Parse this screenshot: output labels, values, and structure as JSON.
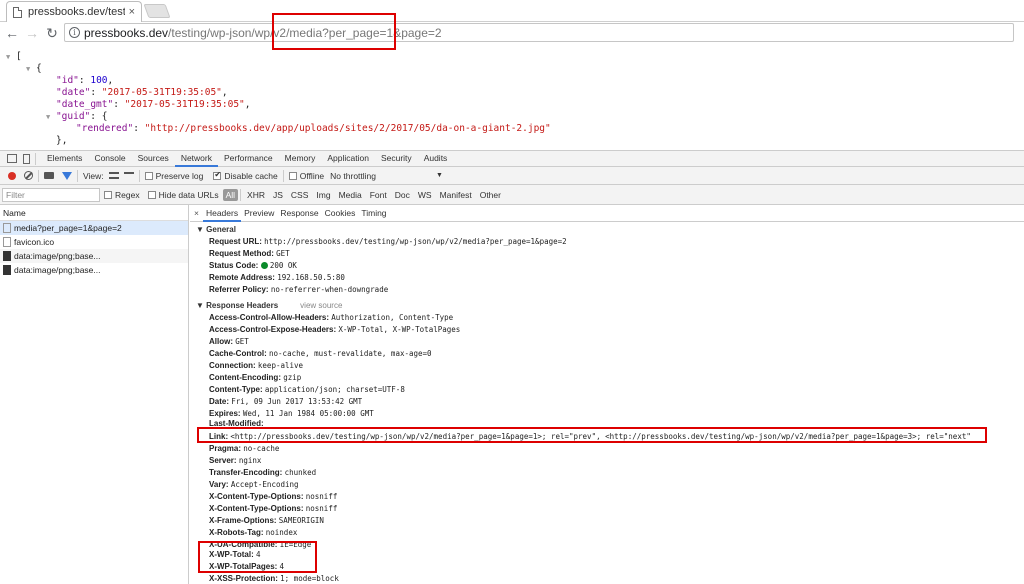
{
  "browser": {
    "tab_title": "pressbooks.dev/testing/w",
    "tab_close": "×",
    "url_host": "pressbooks.dev",
    "url_path": "/testing/wp-json/wp/v2/media?per_page=1&page=2"
  },
  "json_view": {
    "open_bracket": "[",
    "open_brace": "{",
    "id_key": "\"id\"",
    "id_val": "100",
    "date_key": "\"date\"",
    "date_val": "\"2017-05-31T19:35:05\"",
    "date_gmt_key": "\"date_gmt\"",
    "date_gmt_val": "\"2017-05-31T19:35:05\"",
    "guid_key": "\"guid\"",
    "rendered_key": "\"rendered\"",
    "rendered_val": "\"http://pressbooks.dev/app/uploads/sites/2/2017/05/da-on-a-giant-2.jpg\"",
    "close_brace": "},"
  },
  "devtools": {
    "tabs": [
      "Elements",
      "Console",
      "Sources",
      "Network",
      "Performance",
      "Memory",
      "Application",
      "Security",
      "Audits"
    ],
    "active_tab": "Network",
    "toolbar": {
      "view_label": "View:",
      "preserve_log": "Preserve log",
      "disable_cache": "Disable cache",
      "offline": "Offline",
      "throttling": "No throttling"
    },
    "filter": {
      "placeholder": "Filter",
      "regex": "Regex",
      "hide_data_urls": "Hide data URLs",
      "types": [
        "All",
        "XHR",
        "JS",
        "CSS",
        "Img",
        "Media",
        "Font",
        "Doc",
        "WS",
        "Manifest",
        "Other"
      ]
    },
    "requests": {
      "header": "Name",
      "items": [
        "media?per_page=1&page=2",
        "favicon.ico",
        "data:image/png;base...",
        "data:image/png;base..."
      ]
    },
    "detail_tabs": [
      "Headers",
      "Preview",
      "Response",
      "Cookies",
      "Timing"
    ],
    "general": {
      "title": "General",
      "request_url_name": "Request URL:",
      "request_url_value": "http://pressbooks.dev/testing/wp-json/wp/v2/media?per_page=1&page=2",
      "request_method_name": "Request Method:",
      "request_method_value": "GET",
      "status_code_name": "Status Code:",
      "status_code_value": "200 OK",
      "remote_address_name": "Remote Address:",
      "remote_address_value": "192.168.50.5:80",
      "referrer_policy_name": "Referrer Policy:",
      "referrer_policy_value": "no-referrer-when-downgrade"
    },
    "response_headers": {
      "title": "Response Headers",
      "view_source": "view source",
      "items": [
        {
          "name": "Access-Control-Allow-Headers:",
          "value": "Authorization, Content-Type"
        },
        {
          "name": "Access-Control-Expose-Headers:",
          "value": "X-WP-Total, X-WP-TotalPages"
        },
        {
          "name": "Allow:",
          "value": "GET"
        },
        {
          "name": "Cache-Control:",
          "value": "no-cache, must-revalidate, max-age=0"
        },
        {
          "name": "Connection:",
          "value": "keep-alive"
        },
        {
          "name": "Content-Encoding:",
          "value": "gzip"
        },
        {
          "name": "Content-Type:",
          "value": "application/json; charset=UTF-8"
        },
        {
          "name": "Date:",
          "value": "Fri, 09 Jun 2017 13:53:42 GMT"
        },
        {
          "name": "Expires:",
          "value": "Wed, 11 Jan 1984 05:00:00 GMT"
        },
        {
          "name": "Last-Modified:",
          "value": ""
        },
        {
          "name": "Link:",
          "value": "<http://pressbooks.dev/testing/wp-json/wp/v2/media?per_page=1&page=1>; rel=\"prev\", <http://pressbooks.dev/testing/wp-json/wp/v2/media?per_page=1&page=3>; rel=\"next\""
        },
        {
          "name": "Pragma:",
          "value": "no-cache"
        },
        {
          "name": "Server:",
          "value": "nginx"
        },
        {
          "name": "Transfer-Encoding:",
          "value": "chunked"
        },
        {
          "name": "Vary:",
          "value": "Accept-Encoding"
        },
        {
          "name": "X-Content-Type-Options:",
          "value": "nosniff"
        },
        {
          "name": "X-Content-Type-Options:",
          "value": "nosniff"
        },
        {
          "name": "X-Frame-Options:",
          "value": "SAMEORIGIN"
        },
        {
          "name": "X-Robots-Tag:",
          "value": "noindex"
        },
        {
          "name": "X-UA-Compatible:",
          "value": "IE=Edge"
        },
        {
          "name": "X-WP-Total:",
          "value": "4"
        },
        {
          "name": "X-WP-TotalPages:",
          "value": "4"
        },
        {
          "name": "X-XSS-Protection:",
          "value": "1; mode=block"
        }
      ]
    }
  },
  "colors": {
    "highlight": "#dd0000",
    "active_tab_underline": "#3879d9",
    "json_key": "#881391",
    "json_string": "#c41a16",
    "json_number": "#1c00cf",
    "status_ok": "#0a8a2a"
  }
}
